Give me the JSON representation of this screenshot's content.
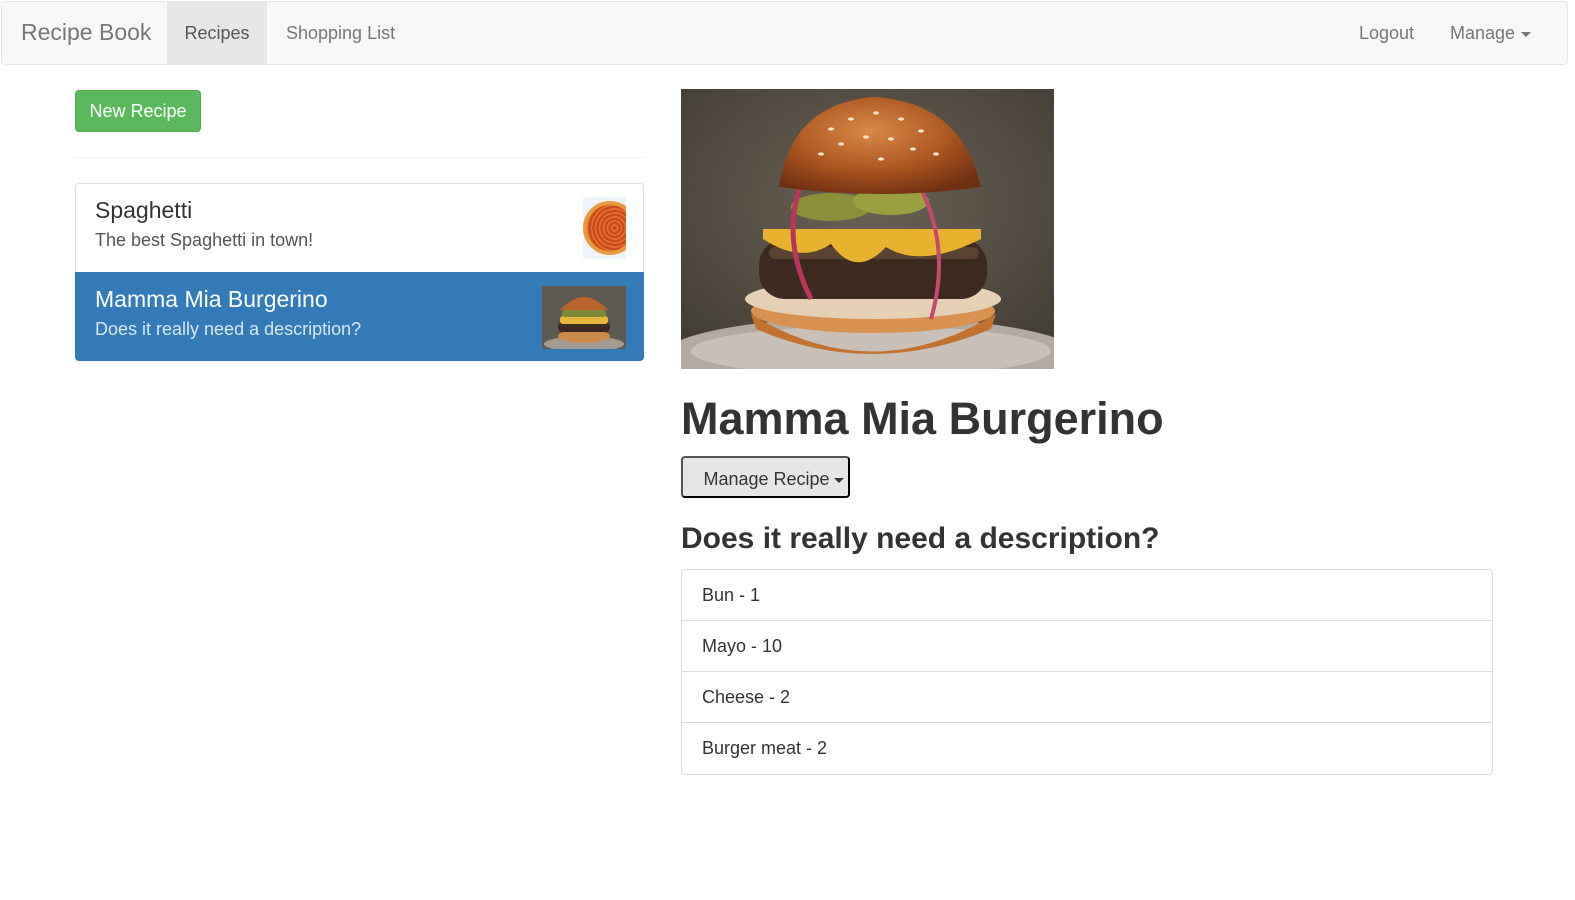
{
  "navbar": {
    "brand": "Recipe Book",
    "links": [
      {
        "label": "Recipes",
        "active": true
      },
      {
        "label": "Shopping List",
        "active": false
      }
    ],
    "logout": "Logout",
    "manage": "Manage"
  },
  "sidebar": {
    "new_recipe_label": "New Recipe",
    "recipes": [
      {
        "name": "Spaghetti",
        "description": "The best Spaghetti in town!",
        "active": false
      },
      {
        "name": "Mamma Mia Burgerino",
        "description": "Does it really need a description?",
        "active": true
      }
    ]
  },
  "detail": {
    "title": "Mamma Mia Burgerino",
    "manage_label": "Manage Recipe",
    "description": "Does it really need a description?",
    "ingredients": [
      {
        "name": "Bun",
        "amount": "1"
      },
      {
        "name": "Mayo",
        "amount": "10"
      },
      {
        "name": "Cheese",
        "amount": "2"
      },
      {
        "name": "Burger meat",
        "amount": "2"
      }
    ]
  },
  "colors": {
    "primary": "#337ab7",
    "success": "#5cb85c",
    "navbar_bg": "#f8f8f8"
  }
}
